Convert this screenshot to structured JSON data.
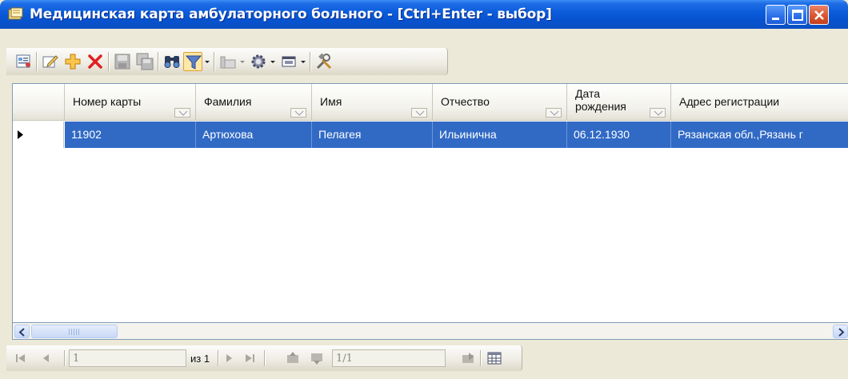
{
  "window": {
    "title": "Медицинская карта амбулаторного больного - [Ctrl+Enter - выбор]"
  },
  "toolbar": {
    "items": [
      "report-icon",
      "edit-icon",
      "add-icon",
      "delete-icon",
      "save-icon",
      "save-all-icon",
      "find-icon",
      "filter-icon",
      "group-icon",
      "settings-icon",
      "window-icon",
      "tools-icon"
    ]
  },
  "grid": {
    "columns": [
      {
        "label": "Номер карты"
      },
      {
        "label": "Фамилия"
      },
      {
        "label": "Имя"
      },
      {
        "label": "Отчество"
      },
      {
        "label": "Дата рождения"
      },
      {
        "label": "Адрес регистрации"
      }
    ],
    "rows": [
      {
        "card_number": "11902",
        "last_name": "Артюхова",
        "first_name": "Пелагея",
        "patronymic": "Ильинична",
        "birth_date": "06.12.1930",
        "address": "Рязанская обл.,Рязань г"
      }
    ]
  },
  "navigator": {
    "page_value": "1",
    "page_of": "из 1",
    "record_value": "1/1"
  },
  "colors": {
    "selection": "#316AC5",
    "titlebar": "#0A5BDA"
  }
}
